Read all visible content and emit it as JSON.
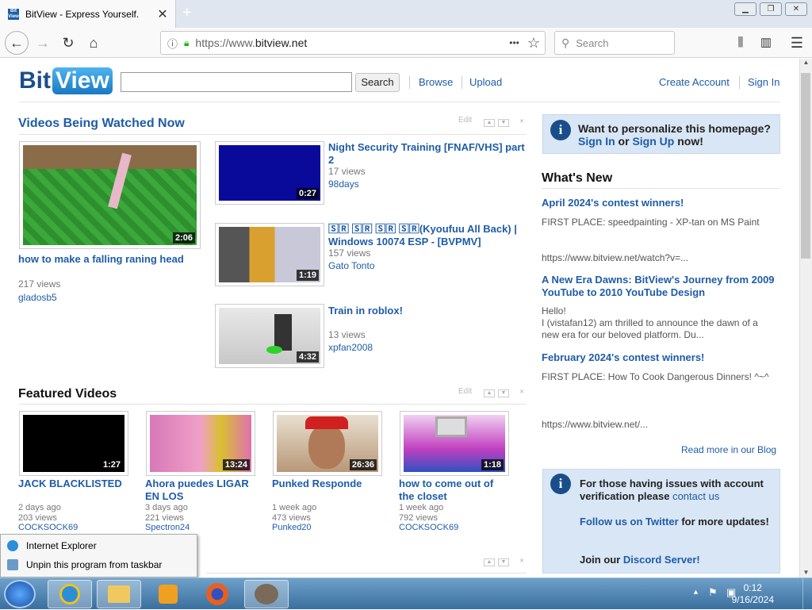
{
  "browser": {
    "tab_title": "BitView - Express Yourself.",
    "favicon_text": "Bit View",
    "url_protocol": "https://www.",
    "url_domain": "bitview.net",
    "search_placeholder": "Search",
    "new_tab": "+",
    "ellipsis": "•••"
  },
  "site": {
    "logo_bit": "Bit",
    "logo_view": "View",
    "search_button": "Search",
    "nav": {
      "browse": "Browse",
      "upload": "Upload",
      "create_account": "Create Account",
      "sign_in": "Sign In"
    }
  },
  "watched": {
    "title": "Videos Being Watched Now",
    "edit": "Edit",
    "main": {
      "title": "how to make a falling raning head",
      "duration": "2:06",
      "views": "217 views",
      "user": "gladosb5"
    },
    "list": [
      {
        "title": "Night Security Training [FNAF/VHS] part 2",
        "duration": "0:27",
        "views": "17 views",
        "user": "98days"
      },
      {
        "title": "🅂🅁 🅂🅁 🅂🅁 🅂🅁(Kyoufuu All Back) | Windows 10074 ESP - [BVPMV]",
        "duration": "1:19",
        "views": "157 views",
        "user": "Gato Tonto"
      },
      {
        "title": "Train in roblox!",
        "duration": "4:32",
        "views": "13 views",
        "user": "xpfan2008"
      }
    ]
  },
  "featured": {
    "title": "Featured Videos",
    "edit": "Edit",
    "items": [
      {
        "title": "JACK BLACKLISTED",
        "duration": "1:27",
        "age": "2 days ago",
        "views": "203 views",
        "user": "COCKSOCK69"
      },
      {
        "title": "Ahora puedes LIGAR EN LOS",
        "duration": "13:24",
        "age": "3 days ago",
        "views": "221 views",
        "user": "Spectron24"
      },
      {
        "title": "Punked Responde",
        "duration": "26:36",
        "age": "1 week ago",
        "views": "473 views",
        "user": "Punked20"
      },
      {
        "title": "how to come out of the closet",
        "duration": "1:18",
        "age": "1 week ago",
        "views": "792 views",
        "user": "COCKSOCK69"
      }
    ]
  },
  "sidebar": {
    "personalize": {
      "line1": "Want to personalize this homepage?",
      "sign_in": "Sign In",
      "or": " or ",
      "sign_up": "Sign Up",
      "now": " now!"
    },
    "whats_new_title": "What's New",
    "posts": [
      {
        "title": "April 2024's contest winners!",
        "text": "FIRST PLACE: speedpainting - XP-tan on MS Paint",
        "link": "https://www.bitview.net/watch?v=..."
      },
      {
        "title": "A New Era Dawns: BitView's Journey from 2009 YouTube to 2010 YouTube Design",
        "text": "Hello!\nI (vistafan12) am thrilled to announce the dawn of a new era for our beloved platform. Du..."
      },
      {
        "title": "February 2024's contest winners!",
        "text": "FIRST PLACE: How To Cook Dangerous Dinners! ^~^",
        "link": "https://www.bitview.net/..."
      }
    ],
    "read_more": "Read more in our Blog",
    "issues": {
      "text1": "For those having issues with account verification please ",
      "contact": "contact us",
      "follow": "Follow us on Twitter",
      "more": " for more updates!",
      "join": "Join our ",
      "discord": "Discord Server!"
    }
  },
  "context_menu": {
    "item1": "Internet Explorer",
    "item2": "Unpin this program from taskbar"
  },
  "taskbar": {
    "time": "0:12",
    "date": "9/16/2024"
  },
  "colors": {
    "link": "#1e5ca8",
    "sidebox": "#d9e6f5",
    "logo_blue": "#1879c4"
  }
}
